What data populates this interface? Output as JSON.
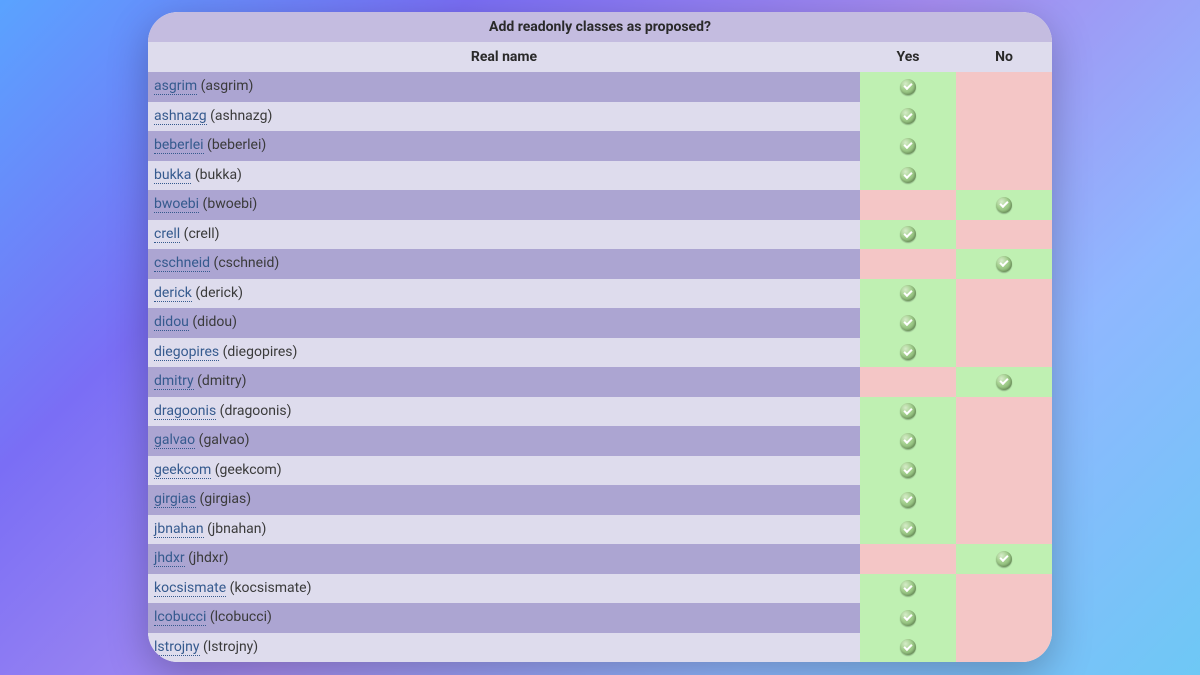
{
  "title": "Add readonly classes as proposed?",
  "headers": {
    "name": "Real name",
    "yes": "Yes",
    "no": "No"
  },
  "rows": [
    {
      "user": "asgrim",
      "display": "asgrim",
      "vote": "yes"
    },
    {
      "user": "ashnazg",
      "display": "ashnazg",
      "vote": "yes"
    },
    {
      "user": "beberlei",
      "display": "beberlei",
      "vote": "yes"
    },
    {
      "user": "bukka",
      "display": "bukka",
      "vote": "yes"
    },
    {
      "user": "bwoebi",
      "display": "bwoebi",
      "vote": "no"
    },
    {
      "user": "crell",
      "display": "crell",
      "vote": "yes"
    },
    {
      "user": "cschneid",
      "display": "cschneid",
      "vote": "no"
    },
    {
      "user": "derick",
      "display": "derick",
      "vote": "yes"
    },
    {
      "user": "didou",
      "display": "didou",
      "vote": "yes"
    },
    {
      "user": "diegopires",
      "display": "diegopires",
      "vote": "yes"
    },
    {
      "user": "dmitry",
      "display": "dmitry",
      "vote": "no"
    },
    {
      "user": "dragoonis",
      "display": "dragoonis",
      "vote": "yes"
    },
    {
      "user": "galvao",
      "display": "galvao",
      "vote": "yes"
    },
    {
      "user": "geekcom",
      "display": "geekcom",
      "vote": "yes"
    },
    {
      "user": "girgias",
      "display": "girgias",
      "vote": "yes"
    },
    {
      "user": "jbnahan",
      "display": "jbnahan",
      "vote": "yes"
    },
    {
      "user": "jhdxr",
      "display": "jhdxr",
      "vote": "no"
    },
    {
      "user": "kocsismate",
      "display": "kocsismate",
      "vote": "yes"
    },
    {
      "user": "lcobucci",
      "display": "lcobucci",
      "vote": "yes"
    },
    {
      "user": "lstrojny",
      "display": "lstrojny",
      "vote": "yes"
    }
  ]
}
